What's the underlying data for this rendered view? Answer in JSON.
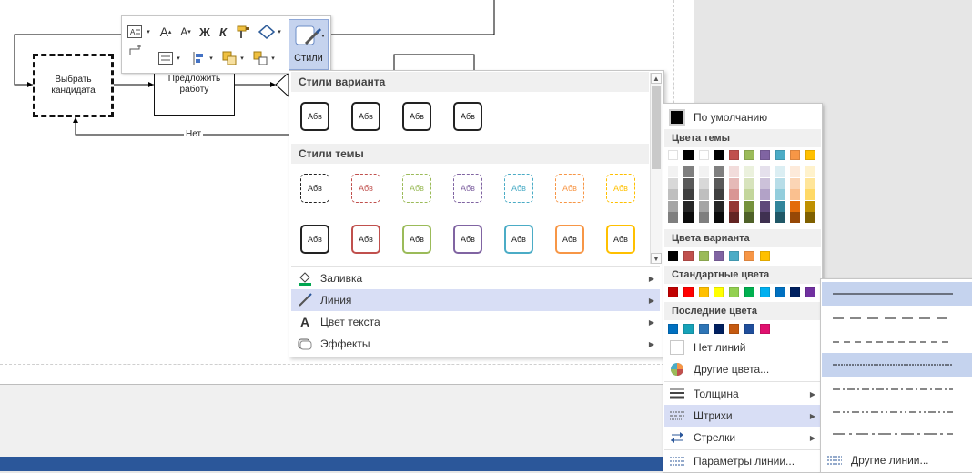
{
  "diagram": {
    "shapes": {
      "select_candidate": "Выбрать кандидата",
      "offer_job": "Предложить работу"
    },
    "connector_no_label": "Нет"
  },
  "mini_toolbar": {
    "styles_label": "Стили",
    "italic_label": "К",
    "bold_label": "Ж"
  },
  "styles_menu": {
    "variant_styles_header": "Стили варианта",
    "theme_styles_header": "Стили темы",
    "swatch_text": "Абв",
    "items": [
      {
        "label": "Заливка",
        "icon": "fill-bucket-icon"
      },
      {
        "label": "Линия",
        "icon": "line-pen-icon"
      },
      {
        "label": "Цвет текста",
        "icon": "text-color-icon"
      },
      {
        "label": "Эффекты",
        "icon": "effects-icon"
      }
    ],
    "variant_colors": [
      "#222222",
      "#222222",
      "#222222",
      "#222222"
    ],
    "theme_row1_colors": [
      "#222222",
      "#c0504d",
      "#9bbb59",
      "#8064a2",
      "#4bacc6",
      "#f79646",
      "#ffc000"
    ],
    "theme_row2_colors": [
      "#222222",
      "#c0504d",
      "#9bbb59",
      "#8064a2",
      "#4bacc6",
      "#f79646",
      "#ffc000"
    ]
  },
  "color_menu": {
    "default_label": "По умолчанию",
    "theme_colors_header": "Цвета темы",
    "variant_colors_header": "Цвета варианта",
    "standard_colors_header": "Стандартные цвета",
    "recent_colors_header": "Последние цвета",
    "no_lines_label": "Нет линий",
    "more_colors_label": "Другие цвета...",
    "weight_label": "Толщина",
    "dashes_label": "Штрихи",
    "arrows_label": "Стрелки",
    "line_options_label": "Параметры линии...",
    "theme_top_row": [
      "#ffffff",
      "#000000",
      "#ffffff",
      "#000000",
      "#c0504d",
      "#9bbb59",
      "#8064a2",
      "#4bacc6",
      "#f79646",
      "#ffc000"
    ],
    "theme_shades": [
      [
        "#f2f2f2",
        "#7f7f7f",
        "#f2f2f2",
        "#7f7f7f",
        "#f2dcdb",
        "#ebf1dd",
        "#e5e0ec",
        "#dbeef3",
        "#fdeada",
        "#fff2cc"
      ],
      [
        "#d8d8d8",
        "#595959",
        "#d8d8d8",
        "#595959",
        "#e5b9b7",
        "#d7e3bc",
        "#ccc1d9",
        "#b7dde8",
        "#fbd5b5",
        "#ffe599"
      ],
      [
        "#bfbfbf",
        "#3f3f3f",
        "#bfbfbf",
        "#3f3f3f",
        "#d99694",
        "#c3d69b",
        "#b2a2c7",
        "#92cddc",
        "#fac08f",
        "#ffd966"
      ],
      [
        "#a5a5a5",
        "#262626",
        "#a5a5a5",
        "#262626",
        "#953734",
        "#76923c",
        "#5f497a",
        "#31859b",
        "#e36c09",
        "#bf9000"
      ],
      [
        "#7f7f7f",
        "#0c0c0c",
        "#7f7f7f",
        "#0c0c0c",
        "#632423",
        "#4f6128",
        "#3f3151",
        "#205867",
        "#974806",
        "#7f6000"
      ]
    ],
    "variant_row": [
      "#000000",
      "#c0504d",
      "#9bbb59",
      "#8064a2",
      "#4bacc6",
      "#f79646",
      "#ffc000"
    ],
    "standard_row": [
      "#c00000",
      "#ff0000",
      "#ffc000",
      "#ffff00",
      "#92d050",
      "#00b050",
      "#00b0f0",
      "#0070c0",
      "#002060",
      "#7030a0"
    ],
    "recent_row": [
      "#0070c0",
      "#17a2b8",
      "#2e75b6",
      "#002060",
      "#c55a11",
      "#1f4e9b",
      "#e0106f"
    ]
  },
  "dash_menu": {
    "more_lines_label": "Другие линии..."
  }
}
